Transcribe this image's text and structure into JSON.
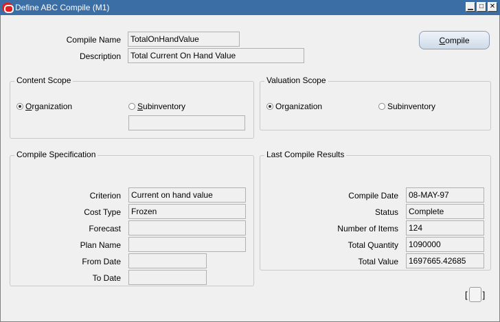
{
  "window": {
    "title": "Define ABC Compile (M1)"
  },
  "header": {
    "compile_name_label": "Compile Name",
    "compile_name_value": "TotalOnHandValue",
    "description_label": "Description",
    "description_value": "Total Current On Hand Value",
    "compile_button": {
      "accel": "C",
      "rest": "ompile"
    }
  },
  "content_scope": {
    "title": "Content Scope",
    "organization": {
      "accel": "O",
      "rest": "rganization",
      "selected": true
    },
    "subinventory": {
      "accel": "S",
      "rest": "ubinventory",
      "selected": false
    },
    "subinventory_value": ""
  },
  "valuation_scope": {
    "title": "Valuation Scope",
    "organization": {
      "label": "Organization",
      "selected": true
    },
    "subinventory": {
      "label": "Subinventory",
      "selected": false
    }
  },
  "compile_spec": {
    "title": "Compile Specification",
    "fields": [
      {
        "label": "Criterion",
        "value": "Current on hand value"
      },
      {
        "label": "Cost Type",
        "value": "Frozen"
      },
      {
        "label": "Forecast",
        "value": ""
      },
      {
        "label": "Plan Name",
        "value": ""
      },
      {
        "label": "From Date",
        "value": ""
      },
      {
        "label": "To Date",
        "value": ""
      }
    ]
  },
  "last_results": {
    "title": "Last Compile Results",
    "fields": [
      {
        "label": "Compile Date",
        "value": "08-MAY-97"
      },
      {
        "label": "Status",
        "value": "Complete"
      },
      {
        "label": "Number of Items",
        "value": "124"
      },
      {
        "label": "Total Quantity",
        "value": "1090000"
      },
      {
        "label": "Total Value",
        "value": "1697665.42685"
      }
    ]
  },
  "footer": {
    "bracket_left": "[",
    "bracket_right": "]"
  }
}
